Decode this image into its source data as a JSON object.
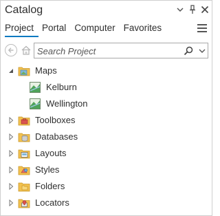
{
  "header": {
    "title": "Catalog",
    "menu_icon": "chevron-down-icon",
    "pin_icon": "pin-icon",
    "close_icon": "close-icon"
  },
  "tabs": [
    {
      "label": "Project",
      "active": true
    },
    {
      "label": "Portal",
      "active": false
    },
    {
      "label": "Computer",
      "active": false
    },
    {
      "label": "Favorites",
      "active": false
    }
  ],
  "search": {
    "placeholder": "Search Project",
    "value": ""
  },
  "tree": {
    "maps": {
      "label": "Maps",
      "expanded": true,
      "children": [
        {
          "label": "Kelburn"
        },
        {
          "label": "Wellington"
        }
      ]
    },
    "items": [
      {
        "label": "Toolboxes"
      },
      {
        "label": "Databases"
      },
      {
        "label": "Layouts"
      },
      {
        "label": "Styles"
      },
      {
        "label": "Folders"
      },
      {
        "label": "Locators"
      }
    ]
  },
  "colors": {
    "accent": "#0079c1",
    "folder": "#f2c14e",
    "border": "#cfcfcf"
  }
}
